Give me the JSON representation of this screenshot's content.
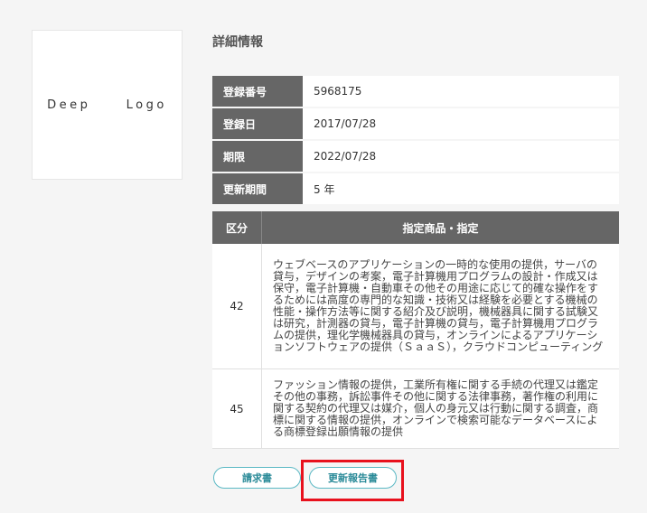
{
  "logo": {
    "text": "Deep  Logo"
  },
  "section_title": "詳細情報",
  "info": [
    {
      "label": "登録番号",
      "value": "5968175"
    },
    {
      "label": "登録日",
      "value": "2017/07/28"
    },
    {
      "label": "期限",
      "value": "2022/07/28"
    },
    {
      "label": "更新期間",
      "value": "5 年"
    }
  ],
  "goods": {
    "header_class": "区分",
    "header_goods": "指定商品・指定",
    "rows": [
      {
        "class": "42",
        "text": "ウェブベースのアプリケーションの一時的な使用の提供，サーバの貸与，デザインの考案，電子計算機用プログラムの設計・作成又は保守，電子計算機・自動車その他その用途に応じて的確な操作をするためには高度の専門的な知識・技術又は経験を必要とする機械の性能・操作方法等に関する紹介及び説明，機械器具に関する試験又は研究，計測器の貸与，電子計算機の貸与，電子計算機用プログラムの提供，理化学機械器具の貸与，オンラインによるアプリケーションソフトウェアの提供（ＳａａＳ），クラウドコンピューティング"
      },
      {
        "class": "45",
        "text": "ファッション情報の提供，工業所有権に関する手続の代理又は鑑定その他の事務，訴訟事件その他に関する法律事務，著作権の利用に関する契約の代理又は媒介，個人の身元又は行動に関する調査，商標に関する情報の提供，オンラインで検索可能なデータベースによる商標登録出願情報の提供"
      }
    ]
  },
  "buttons": {
    "claim": "請求書",
    "renewal_report": "更新報告書"
  },
  "colors": {
    "header_bg": "#666666",
    "button_accent": "#5ab8c4",
    "highlight": "#e8111d"
  }
}
